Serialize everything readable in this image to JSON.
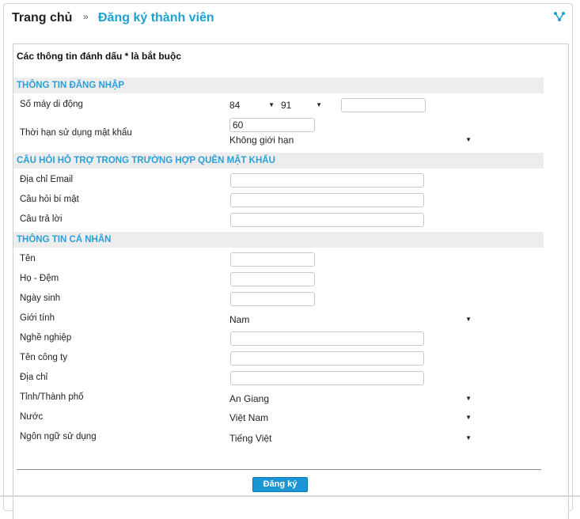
{
  "breadcrumb": {
    "home": "Trang chủ",
    "separator": "»",
    "current": "Đăng ký thành viên"
  },
  "required_note": "Các thông tin đánh dấu * là bắt buộc",
  "sections": {
    "login": "THÔNG TIN ĐĂNG NHẬP",
    "recovery": "CÂU HỎI HỖ TRỢ TRONG TRƯỜNG HỢP QUÊN MẬT KHẨU",
    "personal": "THÔNG TIN CÁ NHÂN"
  },
  "labels": {
    "mobile": "Số máy di động",
    "pw_validity": "Thời hạn sử dụng mật khẩu",
    "email": "Địa chỉ Email",
    "secret_q": "Câu hỏi bí mật",
    "answer": "Câu trả lời",
    "first_name": "Tên",
    "last_name": "Họ - Đệm",
    "dob": "Ngày sinh",
    "gender": "Giới tính",
    "job": "Nghề nghiệp",
    "company": "Tên công ty",
    "address": "Địa chỉ",
    "province": "Tỉnh/Thành phố",
    "country": "Nước",
    "language": "Ngôn ngữ sử dụng"
  },
  "values": {
    "country_code": "84",
    "operator_code": "91",
    "pw_days": "60",
    "pw_limit": "Không giới hạn",
    "gender": "Nam",
    "province": "An Giang",
    "country": "Việt Nam",
    "language": "Tiếng Việt"
  },
  "icons": {
    "share": "share-icon",
    "dropdown": "▼"
  },
  "colors": {
    "accent": "#1ea0d4",
    "section_bg": "#ededed",
    "button": "#1a95d6"
  },
  "submit_label": "Đăng ký"
}
